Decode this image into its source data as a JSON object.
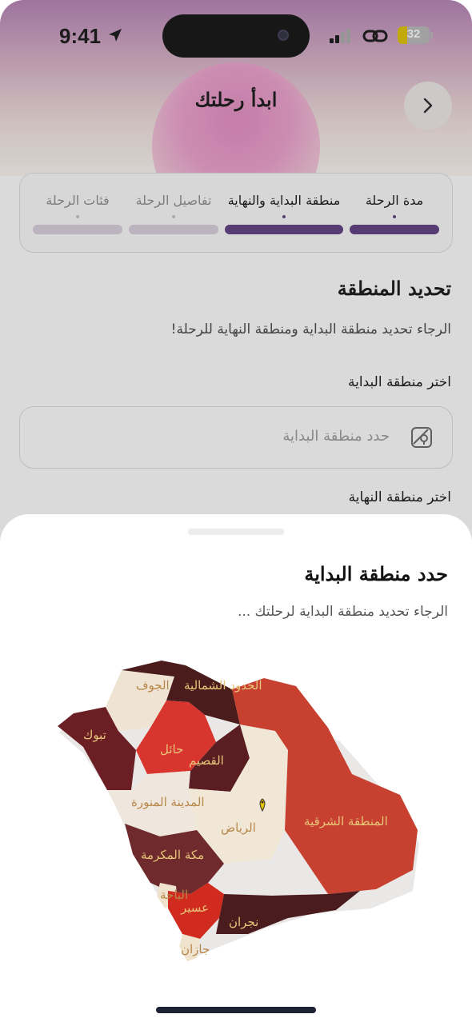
{
  "status_bar": {
    "time": "9:41",
    "battery": "32"
  },
  "header": {
    "title": "ابدأ رحلتك"
  },
  "colors": {
    "accent": "#5b3a7e",
    "inactive_bar": "#d9d0dc"
  },
  "stepper": {
    "steps": [
      {
        "label": "مدة الرحلة",
        "state": "complete"
      },
      {
        "label": "منطقة البداية والنهاية",
        "state": "active"
      },
      {
        "label": "تفاصيل الرحلة",
        "state": "pending"
      },
      {
        "label": "فئات الرحلة",
        "state": "pending"
      }
    ]
  },
  "section": {
    "title": "تحديد المنطقة",
    "subtitle": "الرجاء تحديد منطقة البداية ومنطقة النهاية للرحلة!"
  },
  "start_field": {
    "label": "اختر منطقة البداية",
    "placeholder": "حدد منطقة البداية"
  },
  "end_field": {
    "label": "اختر منطقة النهاية"
  },
  "sheet": {
    "title": "حدد منطقة البداية",
    "subtitle": "الرجاء تحديد منطقة البداية لرحلتك ...",
    "regions": [
      {
        "name": "الجوف"
      },
      {
        "name": "الحدود الشمالية"
      },
      {
        "name": "تبوك"
      },
      {
        "name": "حائل"
      },
      {
        "name": "القصيم"
      },
      {
        "name": "المدينة المنورة"
      },
      {
        "name": "الرياض"
      },
      {
        "name": "المنطقة الشرقية"
      },
      {
        "name": "مكة المكرمة"
      },
      {
        "name": "الباحة"
      },
      {
        "name": "عسير"
      },
      {
        "name": "جازان"
      },
      {
        "name": "نجران"
      }
    ]
  }
}
